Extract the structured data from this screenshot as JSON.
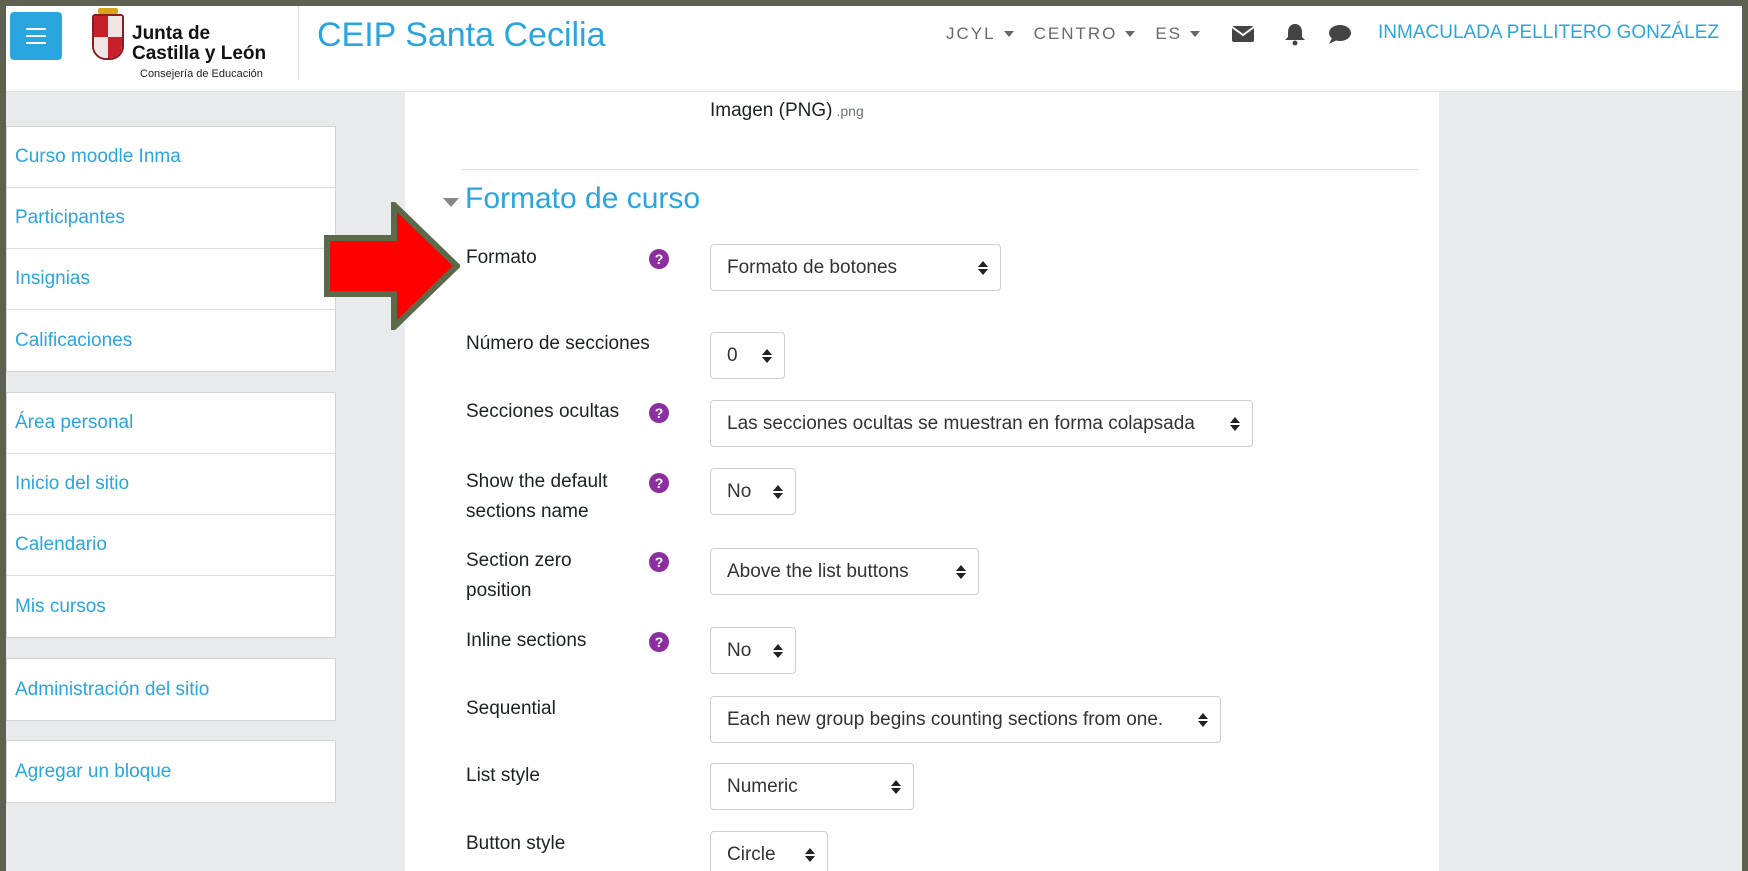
{
  "navbar": {
    "logo": {
      "line1": "Junta de",
      "line2": "Castilla y León",
      "line3": "Consejería de Educación"
    },
    "site_title": "CEIP Santa Cecilia",
    "menus": [
      "JCYL",
      "CENTRO",
      "ES"
    ],
    "icons": [
      "envelope-icon",
      "bell-icon",
      "chat-icon",
      "hamburger-icon"
    ],
    "user_name": "INMACULADA PELLITERO GONZÁLEZ"
  },
  "sidebar": {
    "block1": [
      "Curso moodle Inma",
      "Participantes",
      "Insignias",
      "Calificaciones"
    ],
    "block2": [
      "Área personal",
      "Inicio del sitio",
      "Calendario",
      "Mis cursos"
    ],
    "block3": [
      "Administración del sitio"
    ],
    "block4": [
      "Agregar un bloque"
    ]
  },
  "main": {
    "filetype_label": "Imagen (PNG)",
    "filetype_ext": ".png",
    "section_title": "Formato de curso",
    "fields": [
      {
        "label": "Formato",
        "value": "Formato de botones",
        "help": true
      },
      {
        "label": "Número de secciones",
        "value": "0",
        "help": false
      },
      {
        "label": "Secciones ocultas",
        "value": "Las secciones ocultas se muestran en forma colapsada",
        "help": true
      },
      {
        "label": "Show the default sections name",
        "value": "No",
        "help": true
      },
      {
        "label": "Section zero position",
        "value": "Above the list buttons",
        "help": true
      },
      {
        "label": "Inline sections",
        "value": "No",
        "help": true
      },
      {
        "label": "Sequential",
        "value": "Each new group begins counting sections from one.",
        "help": false
      },
      {
        "label": "List style",
        "value": "Numeric",
        "help": false
      },
      {
        "label": "Button style",
        "value": "Circle",
        "help": false
      }
    ]
  },
  "colors": {
    "accent": "#29a6e0",
    "help_icon": "#8b2fa0",
    "arrow_fill": "#ff0000",
    "arrow_outline": "#5a6a4a",
    "frame": "#5e6052",
    "sidebar_bg": "#e9eaec"
  }
}
